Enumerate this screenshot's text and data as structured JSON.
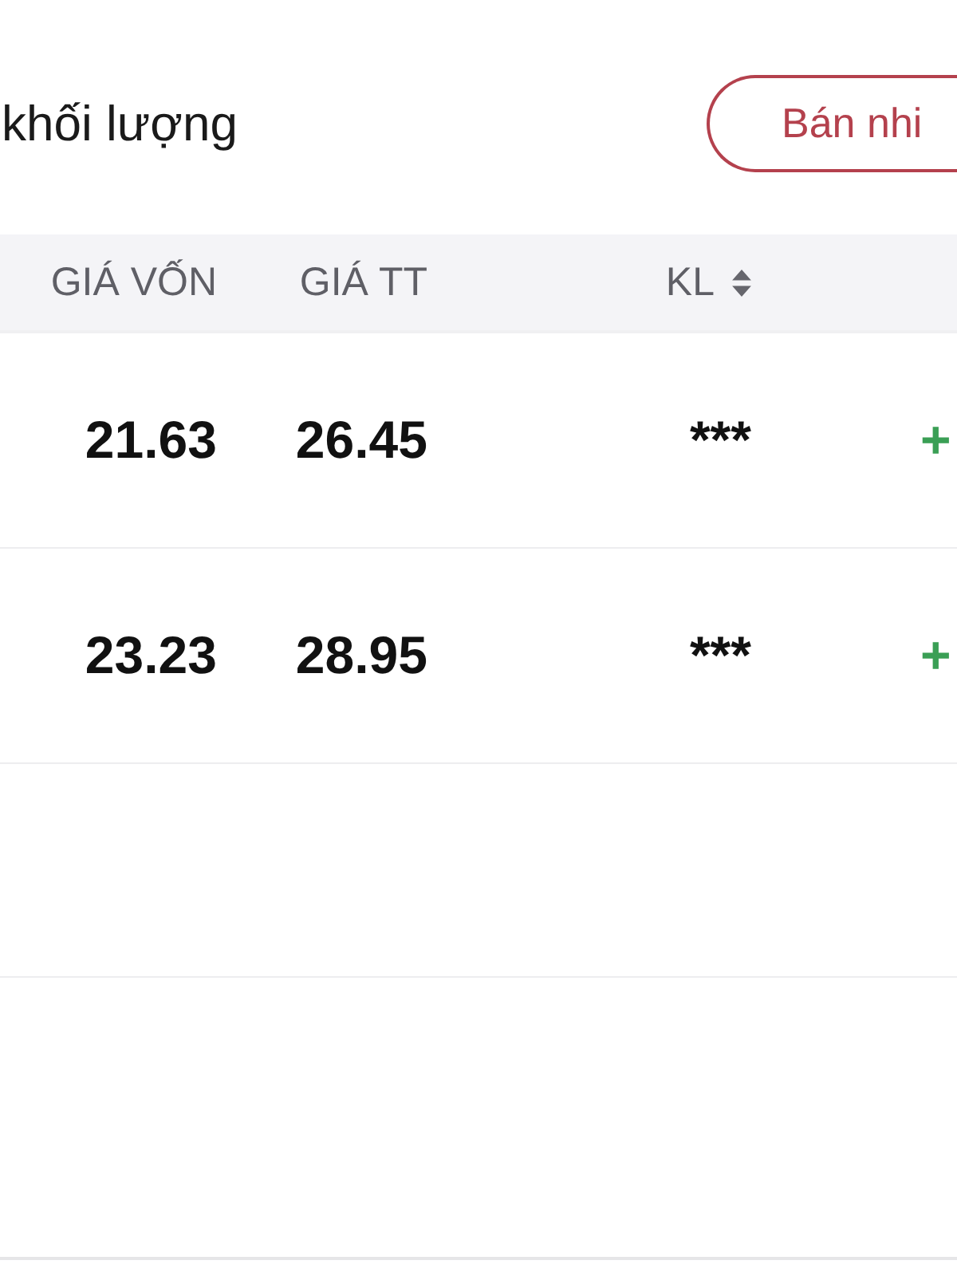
{
  "header": {
    "title": "khối lượng",
    "action_button": "Bán nhi"
  },
  "table": {
    "columns": [
      {
        "label": "GIÁ VỐN",
        "sortable": false
      },
      {
        "label": "GIÁ TT",
        "sortable": false
      },
      {
        "label": "KL",
        "sortable": true
      }
    ],
    "rows": [
      {
        "cells": [
          "21.63",
          "26.45",
          "***"
        ],
        "change": "+",
        "positive": true
      },
      {
        "cells": [
          "23.23",
          "28.95",
          "***"
        ],
        "change": "+",
        "positive": true
      }
    ]
  }
}
